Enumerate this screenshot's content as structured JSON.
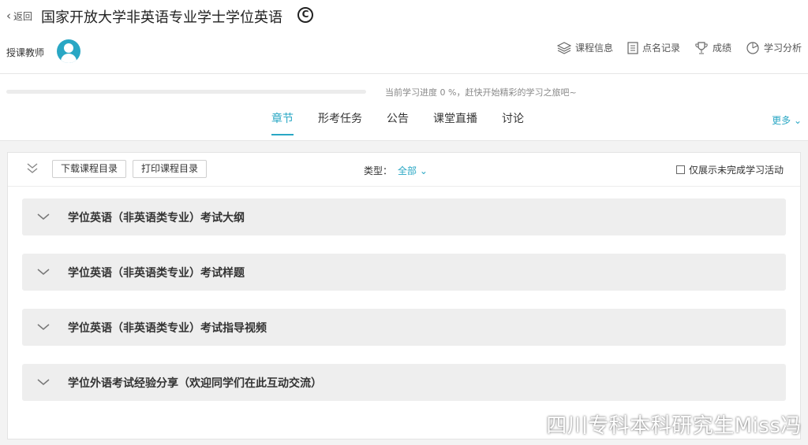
{
  "header": {
    "back_label": "返回",
    "course_title": "国家开放大学非英语专业学士学位英语"
  },
  "teacher": {
    "label": "授课教师"
  },
  "topnav": {
    "items": [
      {
        "label": "课程信息",
        "icon": "layers-icon"
      },
      {
        "label": "点名记录",
        "icon": "document-icon"
      },
      {
        "label": "成绩",
        "icon": "trophy-icon"
      },
      {
        "label": "学习分析",
        "icon": "pie-chart-icon"
      }
    ]
  },
  "progress": {
    "percent": 0,
    "text": "当前学习进度 0 %，赶快开始精彩的学习之旅吧~"
  },
  "tabs": [
    {
      "label": "章节",
      "active": true
    },
    {
      "label": "形考任务",
      "active": false
    },
    {
      "label": "公告",
      "active": false
    },
    {
      "label": "课堂直播",
      "active": false
    },
    {
      "label": "讨论",
      "active": false
    }
  ],
  "more_label": "更多",
  "toolbar": {
    "download_label": "下载课程目录",
    "print_label": "打印课程目录",
    "type_label": "类型：",
    "type_value": "全部",
    "filter_label": "仅展示未完成学习活动"
  },
  "chapters": [
    {
      "label": "学位英语（非英语类专业）考试大纲"
    },
    {
      "label": "学位英语（非英语类专业）考试样题"
    },
    {
      "label": "学位英语（非英语类专业）考试指导视频"
    },
    {
      "label": "学位外语考试经验分享（欢迎同学们在此互动交流）"
    }
  ],
  "watermark": "四川专科本科研究生Miss冯",
  "colors": {
    "accent": "#29a7c4",
    "chapter_bg": "#eeeeee"
  }
}
